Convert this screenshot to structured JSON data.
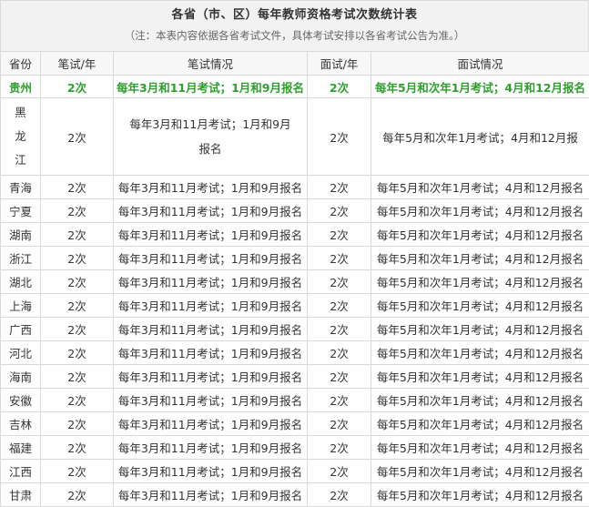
{
  "header": {
    "title": "各省（市、区）每年教师资格考试次数统计表",
    "note": "（注：本表内容依据各省考试文件，具体考试安排以各省考试公告为准。）"
  },
  "columns": [
    "省份",
    "笔试/年",
    "笔试情况",
    "面试/年",
    "面试情况"
  ],
  "highlight_row": {
    "province": "贵州",
    "written_count": "2次",
    "written_info": "每年3月和11月考试；1月和9月报名",
    "interview_count": "2次",
    "interview_info": "每年5月和次年1月考试；4月和12月报名"
  },
  "tall_row": {
    "province_chars": [
      "黑",
      "龙",
      "江"
    ],
    "written_count": "2次",
    "written_info": "每年3月和11月考试；1月和9月报名",
    "interview_count": "2次",
    "interview_info": "每年5月和次年1月考试；4月和12月报"
  },
  "rows": [
    {
      "province": "青海",
      "written_count": "2次",
      "written_info": "每年3月和11月考试；1月和9月报名",
      "interview_count": "2次",
      "interview_info": "每年5月和次年1月考试；4月和12月报名"
    },
    {
      "province": "宁夏",
      "written_count": "2次",
      "written_info": "每年3月和11月考试；1月和9月报名",
      "interview_count": "2次",
      "interview_info": "每年5月和次年1月考试；4月和12月报名"
    },
    {
      "province": "湖南",
      "written_count": "2次",
      "written_info": "每年3月和11月考试；1月和9月报名",
      "interview_count": "2次",
      "interview_info": "每年5月和次年1月考试；4月和12月报名"
    },
    {
      "province": "浙江",
      "written_count": "2次",
      "written_info": "每年3月和11月考试；1月和9月报名",
      "interview_count": "2次",
      "interview_info": "每年5月和次年1月考试；4月和12月报名"
    },
    {
      "province": "湖北",
      "written_count": "2次",
      "written_info": "每年3月和11月考试；1月和9月报名",
      "interview_count": "2次",
      "interview_info": "每年5月和次年1月考试；4月和12月报名"
    },
    {
      "province": "上海",
      "written_count": "2次",
      "written_info": "每年3月和11月考试；1月和9月报名",
      "interview_count": "2次",
      "interview_info": "每年5月和次年1月考试；4月和12月报名"
    },
    {
      "province": "广西",
      "written_count": "2次",
      "written_info": "每年3月和11月考试；1月和9月报名",
      "interview_count": "2次",
      "interview_info": "每年5月和次年1月考试；4月和12月报名"
    },
    {
      "province": "河北",
      "written_count": "2次",
      "written_info": "每年3月和11月考试；1月和9月报名",
      "interview_count": "2次",
      "interview_info": "每年5月和次年1月考试；4月和12月报名"
    },
    {
      "province": "海南",
      "written_count": "2次",
      "written_info": "每年3月和11月考试；1月和9月报名",
      "interview_count": "2次",
      "interview_info": "每年5月和次年1月考试；4月和12月报名"
    },
    {
      "province": "安徽",
      "written_count": "2次",
      "written_info": "每年3月和11月考试；1月和9月报名",
      "interview_count": "2次",
      "interview_info": "每年5月和次年1月考试；4月和12月报名"
    },
    {
      "province": "吉林",
      "written_count": "2次",
      "written_info": "每年3月和11月考试；1月和9月报名",
      "interview_count": "2次",
      "interview_info": "每年5月和次年1月考试；4月和12月报名"
    },
    {
      "province": "福建",
      "written_count": "2次",
      "written_info": "每年3月和11月考试；1月和9月报名",
      "interview_count": "2次",
      "interview_info": "每年5月和次年1月考试；4月和12月报名"
    },
    {
      "province": "江西",
      "written_count": "2次",
      "written_info": "每年3月和11月考试；1月和9月报名",
      "interview_count": "2次",
      "interview_info": "每年5月和次年1月考试；4月和12月报名"
    },
    {
      "province": "甘肃",
      "written_count": "2次",
      "written_info": "每年3月和11月考试；1月和9月报名",
      "interview_count": "2次",
      "interview_info": "每年5月和次年1月考试；4月和12月报名"
    }
  ]
}
